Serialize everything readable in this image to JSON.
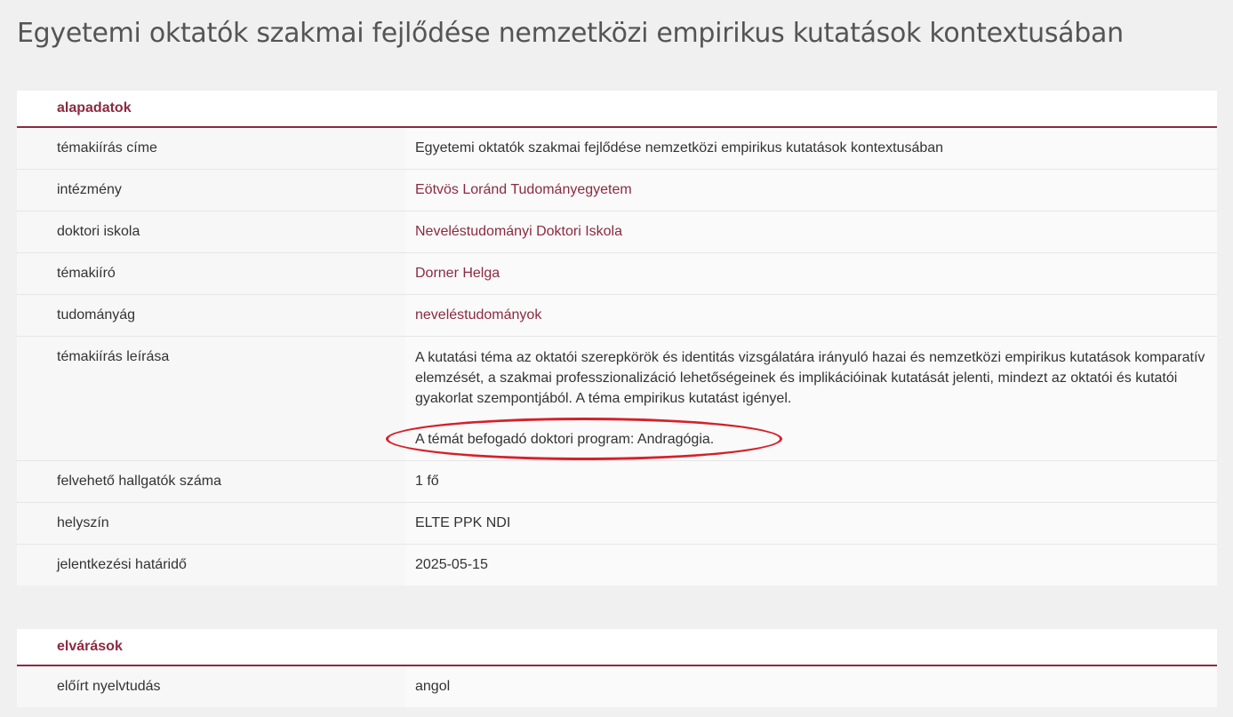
{
  "page": {
    "title": "Egyetemi oktatók szakmai fejlődése nemzetközi empirikus kutatások kontextusában"
  },
  "colors": {
    "accent": "#8b2a42",
    "highlight": "#d6202a",
    "background": "#f0f0f0"
  },
  "basic": {
    "heading": "alapadatok",
    "rows": [
      {
        "label": "témakiírás címe",
        "value": "Egyetemi oktatók szakmai fejlődése nemzetközi empirikus kutatások kontextusában"
      },
      {
        "label": "intézmény",
        "value": "Eötvös Loránd Tudományegyetem"
      },
      {
        "label": "doktori iskola",
        "value": "Neveléstudományi Doktori Iskola"
      },
      {
        "label": "témakiíró",
        "value": "Dorner Helga"
      },
      {
        "label": "tudományág",
        "value": "neveléstudományok"
      },
      {
        "label": "témakiírás leírása",
        "value": "A kutatási téma az oktatói szerepkörök és identitás vizsgálatára irányuló hazai és nemzetközi empirikus kutatások komparatív elemzését, a szakmai professzionalizáció lehetőségeinek és implikációinak kutatását jelenti, mindezt az oktatói és kutatói gyakorlat szempontjából. A téma empirikus kutatást igényel.",
        "value2": "A témát befogadó doktori program: Andragógia."
      },
      {
        "label": "felvehető hallgatók száma",
        "value": "1 fő"
      },
      {
        "label": "helyszín",
        "value": "ELTE PPK NDI"
      },
      {
        "label": "jelentkezési határidő",
        "value": "2025-05-15"
      }
    ]
  },
  "expectations": {
    "heading": "elvárások",
    "rows": [
      {
        "label": "előírt nyelvtudás",
        "value": "angol"
      }
    ]
  }
}
